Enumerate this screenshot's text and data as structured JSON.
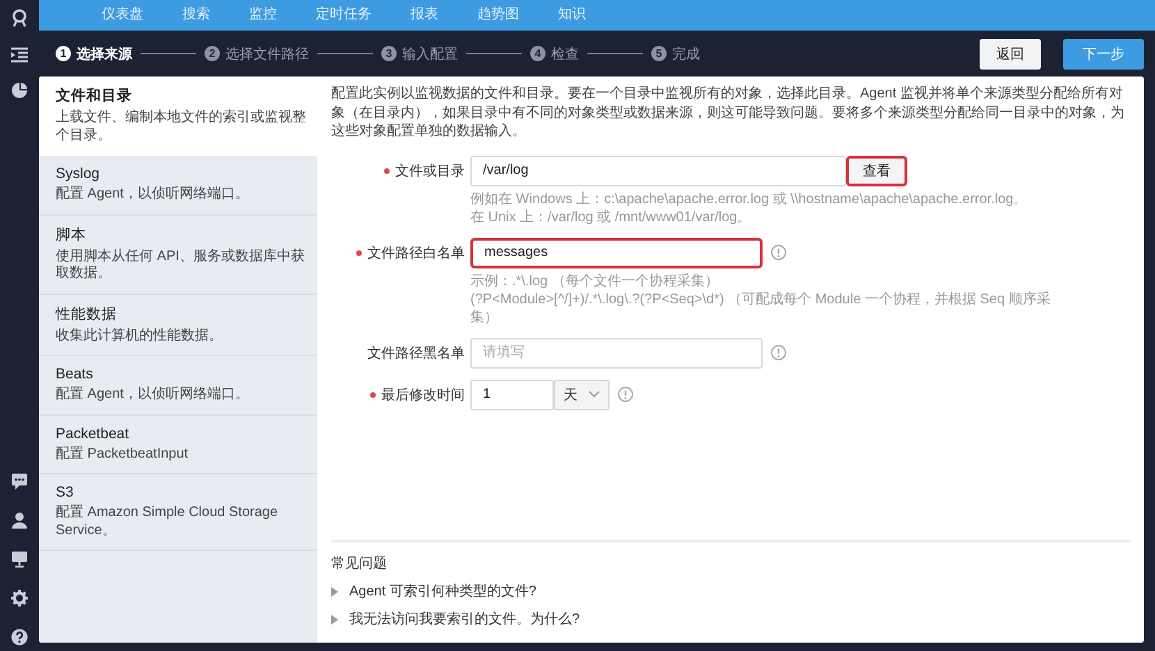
{
  "nav": {
    "items": [
      {
        "label": "仪表盘",
        "selected": false
      },
      {
        "label": "搜索",
        "selected": false
      },
      {
        "label": "监控",
        "selected": false
      },
      {
        "label": "定时任务",
        "selected": false
      },
      {
        "label": "报表",
        "selected": false
      },
      {
        "label": "趋势图",
        "selected": false
      },
      {
        "label": "知识",
        "selected": false
      }
    ]
  },
  "steps": [
    {
      "number": "1",
      "label": "选择来源",
      "selected": true
    },
    {
      "number": "2",
      "label": "选择文件路径",
      "selected": false
    },
    {
      "number": "3",
      "label": "输入配置",
      "selected": false
    },
    {
      "number": "4",
      "label": "检查",
      "selected": false
    },
    {
      "number": "5",
      "label": "完成",
      "selected": false
    }
  ],
  "buttons": {
    "back": "返回",
    "next": "下一步"
  },
  "sources": [
    {
      "title": "文件和目录",
      "description": "上载文件、编制本地文件的索引或监视整个目录。",
      "selected": true
    },
    {
      "title": "Syslog",
      "description": "配置 Agent，以侦听网络端口。",
      "selected": false
    },
    {
      "title": "脚本",
      "description": "使用脚本从任何 API、服务或数据库中获取数据。",
      "selected": false
    },
    {
      "title": "性能数据",
      "description": "收集此计算机的性能数据。",
      "selected": false
    },
    {
      "title": "Beats",
      "description": "配置 Agent，以侦听网络端口。",
      "selected": false
    },
    {
      "title": "Packetbeat",
      "description": "配置 PacketbeatInput",
      "selected": false
    },
    {
      "title": "S3",
      "description": "配置 Amazon Simple Cloud Storage Service。",
      "selected": false
    }
  ],
  "description": "配置此实例以监视数据的文件和目录。要在一个目录中监视所有的对象，选择此目录。Agent 监视并将单个来源类型分配给所有对象（在目录内），如果目录中有不同的对象类型或数据来源，则这可能导致问题。要将多个来源类型分配给同一目录中的对象，为这些对象配置单独的数据输入。",
  "form": {
    "fields": [
      {
        "kind": "path",
        "label": "文件或目录",
        "required": true,
        "value": "/var/log",
        "highlighted": false,
        "info": false,
        "button": {
          "label": "查看",
          "highlighted": true
        },
        "hints": [
          "例如在 Windows 上：c:\\apache\\apache.error.log 或 \\\\hostname\\apache\\apache.error.log。",
          "在 Unix 上：/var/log 或 /mnt/www01/var/log。"
        ]
      },
      {
        "kind": "text",
        "label": "文件路径白名单",
        "required": true,
        "value": "messages",
        "highlighted": true,
        "info": true,
        "hints": [
          "示例：.*\\.log （每个文件一个协程采集）",
          "(?P<Module>[^/]+)/.*\\.log\\.?(?P<Seq>\\d*) （可配成每个 Module 一个协程，并根据 Seq 顺序采集）"
        ]
      },
      {
        "kind": "text",
        "label": "文件路径黑名单",
        "required": false,
        "placeholder": "请填写",
        "highlighted": false,
        "info": true
      },
      {
        "kind": "duration",
        "label": "最后修改时间",
        "required": true,
        "value": "1",
        "unit": "天",
        "highlighted": false,
        "info": true
      }
    ]
  },
  "faq": {
    "title": "常见问题",
    "items": [
      {
        "text": "Agent 可索引何种类型的文件?",
        "expanded": false
      },
      {
        "text": "我无法访问我要索引的文件。为什么?",
        "expanded": false
      }
    ]
  }
}
